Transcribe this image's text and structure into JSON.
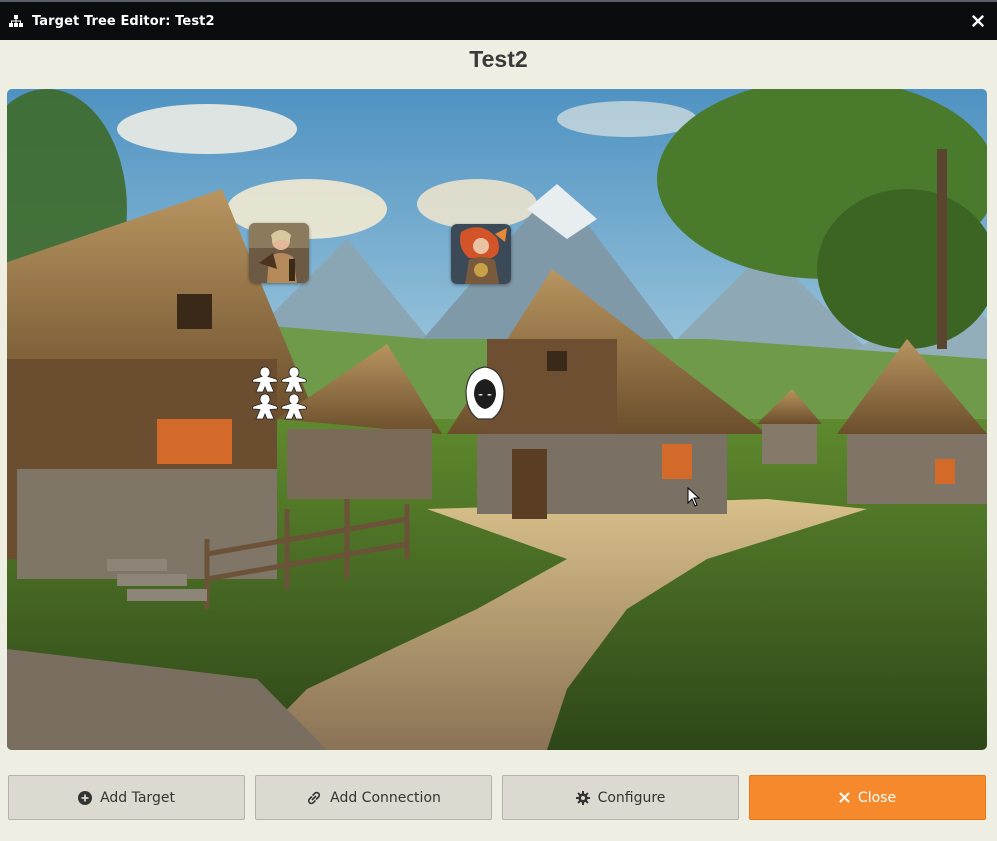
{
  "window": {
    "title": "Target Tree Editor: Test2",
    "title_icon": "sitemap-icon",
    "close_icon": "close-icon"
  },
  "heading": "Test2",
  "canvas": {
    "background": "fantasy village with thatched cottages, dirt path and mountains",
    "nodes": [
      {
        "kind": "portrait",
        "icon": "warrior-portrait-icon"
      },
      {
        "kind": "portrait",
        "icon": "redhead-fighter-portrait-icon"
      },
      {
        "kind": "group",
        "icon": "party-meeples-icon"
      },
      {
        "kind": "npc",
        "icon": "hooded-figure-icon"
      }
    ]
  },
  "buttons": {
    "add_target": {
      "label": "Add Target",
      "icon": "plus-circle-icon"
    },
    "add_connection": {
      "label": "Add Connection",
      "icon": "link-icon"
    },
    "configure": {
      "label": "Configure",
      "icon": "gear-icon"
    },
    "close": {
      "label": "Close",
      "icon": "close-icon"
    }
  },
  "colors": {
    "titlebar": "#0b0c10",
    "window_bg": "#efeee3",
    "button_bg": "#dcdad0",
    "primary": "#f5892c"
  }
}
